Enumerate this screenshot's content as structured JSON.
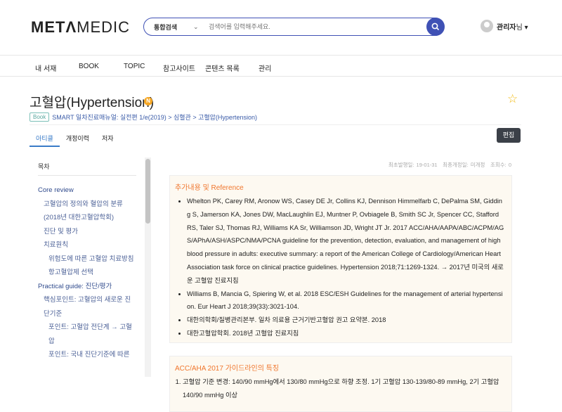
{
  "header": {
    "logo_bold": "METΛ",
    "logo_light": "MEDIC",
    "search_scope": "통합검색",
    "search_placeholder": "검색어를 입력해주세요.",
    "user_name": "관리자",
    "user_suffix": "님 ▾"
  },
  "nav": [
    "내 서재",
    "BOOK",
    "TOPIC",
    "참고사이트",
    "콘텐츠 목록",
    "관리"
  ],
  "article": {
    "title": "고혈압(Hypertension)",
    "new_badge": "N",
    "book_badge": "Book",
    "breadcrumb": "SMART 일차진료매뉴얼: 실전편 1/e(2019) > 심혈관 > 고혈압(Hypertension)",
    "tabs": [
      "아티클",
      "개정이력",
      "저자"
    ],
    "edit_label": "편집",
    "meta": "최초발행일: 19-01-31　최종개정일: 미개정　조회수: 0"
  },
  "toc": {
    "heading": "목차",
    "items": [
      {
        "label": "Core review",
        "level": 1
      },
      {
        "label": "고혈압의 정의와 혈압의 분류(2018년 대한고혈압학회)",
        "level": 2
      },
      {
        "label": "진단 및 평가",
        "level": 2
      },
      {
        "label": "치료원칙",
        "level": 2
      },
      {
        "label": "위험도에 따른 고혈압 치료방침",
        "level": 3
      },
      {
        "label": "항고혈압제 선택",
        "level": 3
      },
      {
        "label": "Practical guide: 진단/평가",
        "level": 1
      },
      {
        "label": "핵심포인트: 고혈압의 새로운 진단기준",
        "level": 2
      },
      {
        "label": "포인트: 고혈압 전단계 → 고혈압",
        "level": 3
      },
      {
        "label": "포인트: 국내 진단기준에 따른",
        "level": 3
      }
    ]
  },
  "reference": {
    "title": "추가내용 및 Reference",
    "items": [
      " Whelton PK, Carey RM, Aronow WS, Casey DE Jr, Collins KJ, Dennison Himmelfarb C, DePalma SM, Gidding S, Jamerson  KA, Jones DW, MacLaughlin EJ, Muntner P, Ovbiagele B, Smith SC Jr, Spencer CC, Stafford RS, Taler SJ, Thomas RJ, Williams KA Sr, Williamson JD, Wright JT Jr. 2017 ACC/AHA/AAPA/ABC/ACPM/AGS/APhA/ASH/ASPC/NMA/PCNA guideline for the prevention, detection, evaluation, and management of high blood pressure in adults: executive summary: a report of the American College of Cardiology/American Heart Association task force on clinical practice guidelines. Hypertension 2018;71:1269-1324. → 2017년 미국의 새로운 고혈압 진료지침",
      "Williams B, Mancia G, Spiering W, et al. 2018 ESC/ESH Guidelines for the management of arterial hypertension. Eur Heart J 2018;39(33):3021-104.",
      "대한의학회/질병관리본부. 일차 의료용 근거기반고혈압 권고 요약본. 2018",
      "대한고혈압학회. 2018년 고혈압 진료지침"
    ]
  },
  "guideline": {
    "title": "ACC/AHA 2017 가이드라인의 특징",
    "items": [
      "고혈압 기준 변경: 140/90 mmHg에서 130/80 mmHg으로 하향 조정. 1기 고혈압 130-139/80-89 mmHg,  2기 고혈압 140/90 mmHg 이상"
    ]
  }
}
